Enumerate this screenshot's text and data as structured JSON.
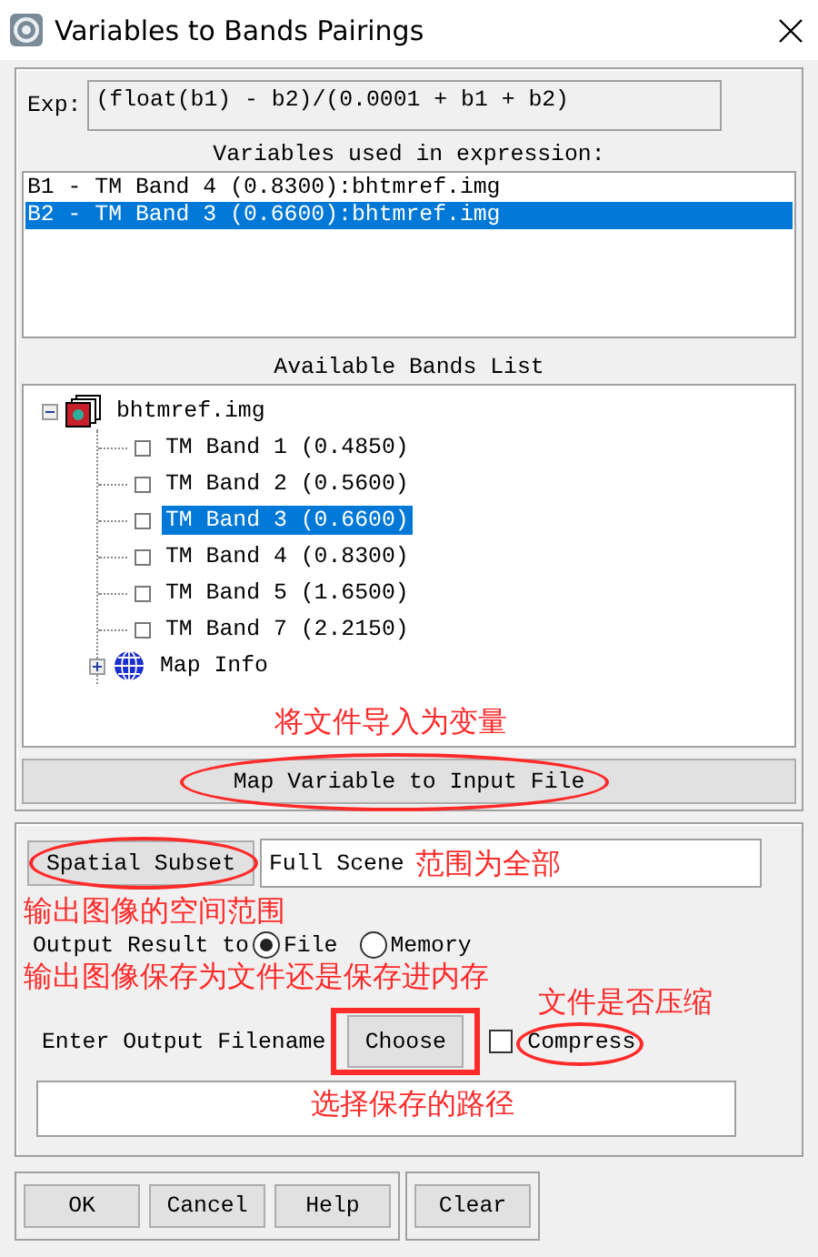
{
  "window": {
    "title": "Variables to Bands Pairings"
  },
  "expression": {
    "label": "Exp:",
    "value": "(float(b1) - b2)/(0.0001 + b1 + b2)"
  },
  "variables": {
    "heading": "Variables used in expression:",
    "items": [
      {
        "label": "B1 - TM Band 4 (0.8300):bhtmref.img",
        "selected": false
      },
      {
        "label": "B2 - TM Band 3 (0.6600):bhtmref.img",
        "selected": true
      }
    ]
  },
  "bands": {
    "heading": "Available Bands List",
    "note": "将文件导入为变量",
    "tree": [
      {
        "label": "bhtmref.img",
        "kind": "file",
        "expanded": true,
        "children": [
          {
            "label": "TM Band 1 (0.4850)",
            "kind": "band",
            "selected": false
          },
          {
            "label": "TM Band 2 (0.5600)",
            "kind": "band",
            "selected": false
          },
          {
            "label": "TM Band 3 (0.6600)",
            "kind": "band",
            "selected": true
          },
          {
            "label": "TM Band 4 (0.8300)",
            "kind": "band",
            "selected": false
          },
          {
            "label": "TM Band 5 (1.6500)",
            "kind": "band",
            "selected": false
          },
          {
            "label": "TM Band 7 (2.2150)",
            "kind": "band",
            "selected": false
          },
          {
            "label": "Map Info",
            "kind": "map",
            "expanded": false
          }
        ]
      }
    ]
  },
  "map_button": {
    "label": "Map Variable to Input File",
    "circled": true
  },
  "spatial_subset": {
    "button": "Spatial Subset",
    "circled": true,
    "note": "输出图像的空间范围",
    "value": "Full Scene",
    "value_note": "范围为全部"
  },
  "output_to": {
    "label": "Output Result to",
    "options": [
      {
        "label": "File",
        "selected": true
      },
      {
        "label": "Memory",
        "selected": false
      }
    ],
    "note": "输出图像保存为文件还是保存进内存"
  },
  "output_filename": {
    "label": "Enter Output Filename",
    "button": "Choose",
    "boxed": true,
    "button_note": "选择保存的路径",
    "compress": {
      "label": "Compress",
      "checked": false,
      "circled": true,
      "note": "文件是否压缩"
    }
  },
  "button_groups": [
    [
      "OK",
      "Cancel",
      "Help"
    ],
    [
      "Clear"
    ]
  ]
}
